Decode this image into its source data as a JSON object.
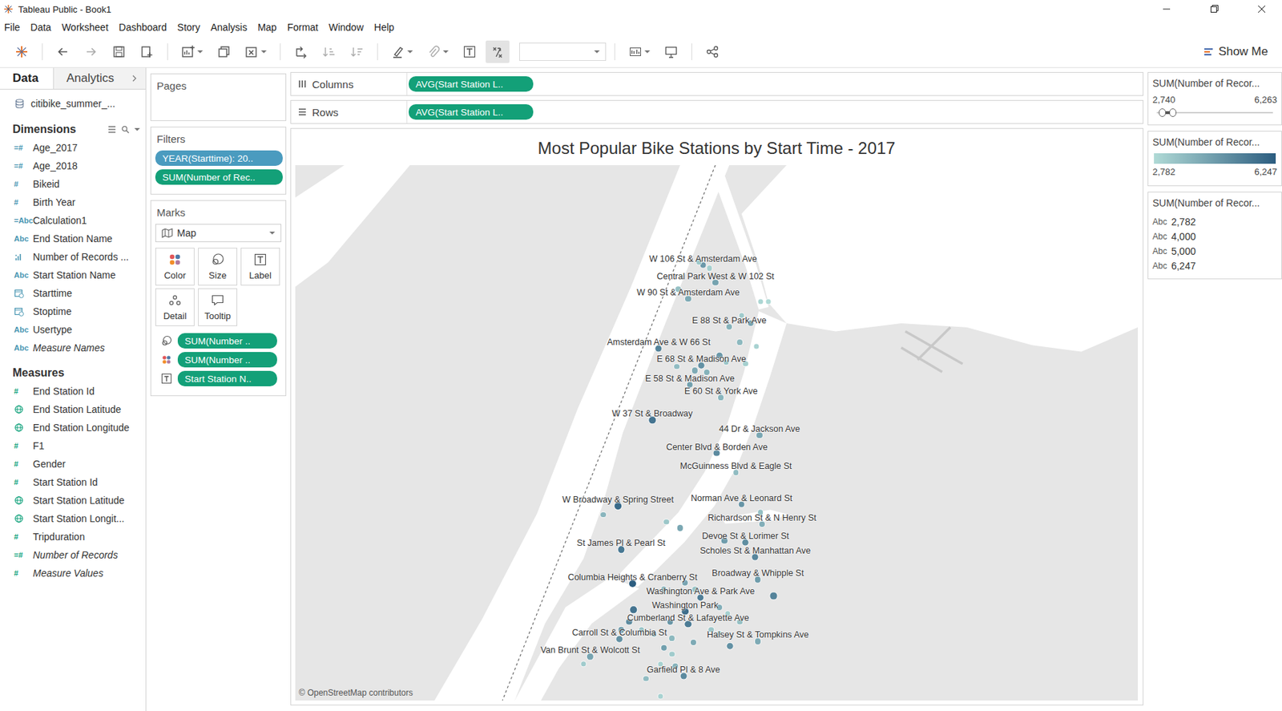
{
  "window": {
    "title": "Tableau Public - Book1"
  },
  "menu": [
    "File",
    "Data",
    "Worksheet",
    "Dashboard",
    "Story",
    "Analysis",
    "Map",
    "Format",
    "Window",
    "Help"
  ],
  "toolbar": {
    "show_me": "Show Me"
  },
  "data_pane": {
    "tabs": [
      {
        "label": "Data",
        "selected": true
      },
      {
        "label": "Analytics",
        "selected": false
      }
    ],
    "source": "citibike_summer_...",
    "dimensions_title": "Dimensions",
    "dimensions": [
      {
        "name": "Age_2017",
        "kind": "glyph",
        "glyph": "=#",
        "italic": false
      },
      {
        "name": "Age_2018",
        "kind": "glyph",
        "glyph": "=#",
        "italic": false
      },
      {
        "name": "Bikeid",
        "kind": "glyph",
        "glyph": "#",
        "italic": false
      },
      {
        "name": "Birth Year",
        "kind": "glyph",
        "glyph": "#",
        "italic": false
      },
      {
        "name": "Calculation1",
        "kind": "glyph",
        "glyph": "=Abc",
        "italic": false
      },
      {
        "name": "End Station Name",
        "kind": "glyph",
        "glyph": "Abc",
        "italic": false
      },
      {
        "name": "Number of Records ...",
        "kind": "bars",
        "glyph": "",
        "italic": false
      },
      {
        "name": "Start Station Name",
        "kind": "glyph",
        "glyph": "Abc",
        "italic": false
      },
      {
        "name": "Starttime",
        "kind": "date",
        "glyph": "",
        "italic": false
      },
      {
        "name": "Stoptime",
        "kind": "date",
        "glyph": "",
        "italic": false
      },
      {
        "name": "Usertype",
        "kind": "glyph",
        "glyph": "Abc",
        "italic": false
      },
      {
        "name": "Measure Names",
        "kind": "glyph",
        "glyph": "Abc",
        "italic": true
      }
    ],
    "measures_title": "Measures",
    "measures": [
      {
        "name": "End Station Id",
        "kind": "glyph",
        "glyph": "#",
        "italic": false
      },
      {
        "name": "End Station Latitude",
        "kind": "geo",
        "glyph": "",
        "italic": false
      },
      {
        "name": "End Station Longitude",
        "kind": "geo",
        "glyph": "",
        "italic": false
      },
      {
        "name": "F1",
        "kind": "glyph",
        "glyph": "#",
        "italic": false
      },
      {
        "name": "Gender",
        "kind": "glyph",
        "glyph": "#",
        "italic": false
      },
      {
        "name": "Start Station Id",
        "kind": "glyph",
        "glyph": "#",
        "italic": false
      },
      {
        "name": "Start Station Latitude",
        "kind": "geo",
        "glyph": "",
        "italic": false
      },
      {
        "name": "Start Station Longit...",
        "kind": "geo",
        "glyph": "",
        "italic": false
      },
      {
        "name": "Tripduration",
        "kind": "glyph",
        "glyph": "#",
        "italic": false
      },
      {
        "name": "Number of Records",
        "kind": "glyph",
        "glyph": "=#",
        "italic": true
      },
      {
        "name": "Measure Values",
        "kind": "glyph",
        "glyph": "#",
        "italic": true
      }
    ]
  },
  "pages": {
    "title": "Pages"
  },
  "filters": {
    "title": "Filters",
    "pills": [
      {
        "label": "YEAR(Starttime): 20..",
        "kind": "dimension"
      },
      {
        "label": "SUM(Number of Rec..",
        "kind": "measure"
      }
    ]
  },
  "marks": {
    "title": "Marks",
    "mark_type": "Map",
    "buttons": [
      {
        "label": "Color",
        "kind": "color"
      },
      {
        "label": "Size",
        "kind": "size"
      },
      {
        "label": "Label",
        "kind": "label"
      },
      {
        "label": "Detail",
        "kind": "detail"
      },
      {
        "label": "Tooltip",
        "kind": "tooltip"
      }
    ],
    "pills": [
      {
        "label": "SUM(Number ..",
        "encoding": "size"
      },
      {
        "label": "SUM(Number ..",
        "encoding": "color"
      },
      {
        "label": "Start Station N..",
        "encoding": "label"
      }
    ]
  },
  "shelves": [
    {
      "label": "Columns",
      "kind": "columns",
      "pill": "AVG(Start Station L.."
    },
    {
      "label": "Rows",
      "kind": "rows",
      "pill": "AVG(Start Station L.."
    }
  ],
  "viz": {
    "title": "Most Popular Bike Stations by Start Time - 2017",
    "attribution": "© OpenStreetMap contributors",
    "points": [
      {
        "label": "W 106 St & Amsterdam Ave",
        "lat": 40.8027,
        "lon": -73.9548,
        "count": 4600
      },
      {
        "label": "Central Park West & W 102 St",
        "lat": 40.7961,
        "lon": -73.9504,
        "count": 4300
      },
      {
        "label": "W 90 St & Amsterdam Ave",
        "lat": 40.79,
        "lon": -73.9601,
        "count": 4100
      },
      {
        "label": "E 88 St & Park Ave",
        "lat": 40.7797,
        "lon": -73.9455,
        "count": 3900
      },
      {
        "label": "Amsterdam Ave & W 66 St",
        "lat": 40.7715,
        "lon": -73.9706,
        "count": 5200
      },
      {
        "label": "E 68 St & Madison Ave",
        "lat": 40.7652,
        "lon": -73.9554,
        "count": 4800
      },
      {
        "label": "E 58 St & Madison Ave",
        "lat": 40.7579,
        "lon": -73.9595,
        "count": 4400
      },
      {
        "label": "E 60 St & York Ave",
        "lat": 40.7533,
        "lon": -73.9484,
        "count": 3800
      },
      {
        "label": "W 37 St & Broadway",
        "lat": 40.7448,
        "lon": -73.9729,
        "count": 5600
      },
      {
        "label": "44 Dr & Jackson Ave",
        "lat": 40.7391,
        "lon": -73.9347,
        "count": 4200
      },
      {
        "label": "Center Blvd & Borden Ave",
        "lat": 40.7324,
        "lon": -73.9499,
        "count": 5000
      },
      {
        "label": "McGuinness Blvd & Eagle St",
        "lat": 40.7251,
        "lon": -73.9431,
        "count": 3600
      },
      {
        "label": "W Broadway & Spring Street",
        "lat": 40.7127,
        "lon": -73.9851,
        "count": 5900
      },
      {
        "label": "Norman Ave & Leonard St",
        "lat": 40.7133,
        "lon": -73.9411,
        "count": 4700
      },
      {
        "label": "Richardson St & N Henry St",
        "lat": 40.7058,
        "lon": -73.9338,
        "count": 4000
      },
      {
        "label": "Devoe St & Lorimer St",
        "lat": 40.6991,
        "lon": -73.9397,
        "count": 4900
      },
      {
        "label": "Scholes St & Manhattan Ave",
        "lat": 40.6936,
        "lon": -73.9362,
        "count": 5100
      },
      {
        "label": "St James Pl & Pearl St",
        "lat": 40.6964,
        "lon": -73.984,
        "count": 5500
      },
      {
        "label": "Broadway & Whipple St",
        "lat": 40.6852,
        "lon": -73.9353,
        "count": 4500
      },
      {
        "label": "Columbia Heights & Cranberry St",
        "lat": 40.6836,
        "lon": -73.9799,
        "count": 6247
      },
      {
        "label": "Washington Ave & Park Ave",
        "lat": 40.6785,
        "lon": -73.9557,
        "count": 5300
      },
      {
        "label": "Washington Park",
        "lat": 40.6733,
        "lon": -73.9612,
        "count": 5800
      },
      {
        "label": "Cumberland St & Lafayette Ave",
        "lat": 40.6685,
        "lon": -73.9601,
        "count": 5400
      },
      {
        "label": "Carroll St & Columbia St",
        "lat": 40.663,
        "lon": -73.9846,
        "count": 4800
      },
      {
        "label": "Halsey St & Tompkins Ave",
        "lat": 40.6621,
        "lon": -73.9353,
        "count": 4100
      },
      {
        "label": "Van Brunt St & Wolcott St",
        "lat": 40.6564,
        "lon": -73.995,
        "count": 4300
      },
      {
        "label": "Garfield Pl & 8 Ave",
        "lat": 40.6491,
        "lon": -73.9618,
        "count": 5000
      },
      {
        "label": "",
        "lat": 40.8039,
        "lon": -73.9563,
        "count": 3300
      },
      {
        "label": "",
        "lat": 40.8015,
        "lon": -73.9525,
        "count": 3100
      },
      {
        "label": "",
        "lat": 40.7936,
        "lon": -73.9636,
        "count": 3500
      },
      {
        "label": "",
        "lat": 40.7891,
        "lon": -73.9344,
        "count": 2900
      },
      {
        "label": "",
        "lat": 40.7891,
        "lon": -73.9315,
        "count": 2782
      },
      {
        "label": "",
        "lat": 40.7839,
        "lon": -73.9411,
        "count": 3200
      },
      {
        "label": "",
        "lat": 40.7809,
        "lon": -73.9379,
        "count": 4400
      },
      {
        "label": "",
        "lat": 40.7739,
        "lon": -73.9417,
        "count": 3700
      },
      {
        "label": "",
        "lat": 40.7724,
        "lon": -73.9359,
        "count": 3000
      },
      {
        "label": "",
        "lat": 40.7688,
        "lon": -73.949,
        "count": 4600
      },
      {
        "label": "",
        "lat": 40.7664,
        "lon": -73.9466,
        "count": 3400
      },
      {
        "label": "",
        "lat": 40.7633,
        "lon": -73.9577,
        "count": 4100
      },
      {
        "label": "",
        "lat": 40.7648,
        "lon": -73.9641,
        "count": 3600
      },
      {
        "label": "",
        "lat": 40.7627,
        "lon": -73.9534,
        "count": 3900
      },
      {
        "label": "",
        "lat": 40.7658,
        "lon": -73.9397,
        "count": 3100
      },
      {
        "label": "",
        "lat": 40.7067,
        "lon": -73.9679,
        "count": 3300
      },
      {
        "label": "",
        "lat": 40.7045,
        "lon": -73.963,
        "count": 4200
      },
      {
        "label": "",
        "lat": 40.7094,
        "lon": -73.9904,
        "count": 3800
      },
      {
        "label": "",
        "lat": 40.7103,
        "lon": -73.9344,
        "count": 3500
      },
      {
        "label": "",
        "lat": 40.6997,
        "lon": -73.9472,
        "count": 4500
      },
      {
        "label": "",
        "lat": 40.6791,
        "lon": -73.9297,
        "count": 5200
      },
      {
        "label": "",
        "lat": 40.6603,
        "lon": -73.9452,
        "count": 4800
      },
      {
        "label": "",
        "lat": 40.6739,
        "lon": -73.9796,
        "count": 5600
      },
      {
        "label": "",
        "lat": 40.6664,
        "lon": -73.9767,
        "count": 3400
      },
      {
        "label": "",
        "lat": 40.6649,
        "lon": -73.9723,
        "count": 3700
      },
      {
        "label": "",
        "lat": 40.6597,
        "lon": -73.9688,
        "count": 4400
      },
      {
        "label": "",
        "lat": 40.6573,
        "lon": -73.9659,
        "count": 3200
      },
      {
        "label": "",
        "lat": 40.6527,
        "lon": -73.9647,
        "count": 3900
      },
      {
        "label": "",
        "lat": 40.6536,
        "lon": -73.97,
        "count": 3000
      },
      {
        "label": "",
        "lat": 40.6482,
        "lon": -73.9752,
        "count": 3600
      },
      {
        "label": "",
        "lat": 40.6618,
        "lon": -73.9583,
        "count": 4100
      },
      {
        "label": "",
        "lat": 40.6664,
        "lon": -73.9519,
        "count": 3300
      },
      {
        "label": "",
        "lat": 40.6652,
        "lon": -73.949,
        "count": 2900
      },
      {
        "label": "",
        "lat": 40.6694,
        "lon": -73.9417,
        "count": 3500
      },
      {
        "label": "",
        "lat": 40.6749,
        "lon": -73.949,
        "count": 4000
      },
      {
        "label": "",
        "lat": 40.6724,
        "lon": -73.9461,
        "count": 3100
      },
      {
        "label": "",
        "lat": 40.6694,
        "lon": -73.9665,
        "count": 4700
      },
      {
        "label": "",
        "lat": 40.6815,
        "lon": -73.9688,
        "count": 3800
      },
      {
        "label": "",
        "lat": 40.6815,
        "lon": -73.9577,
        "count": 3400
      },
      {
        "label": "",
        "lat": 40.6839,
        "lon": -73.9612,
        "count": 4300
      },
      {
        "label": "",
        "lat": 40.6415,
        "lon": -73.97,
        "count": 3000
      },
      {
        "label": "",
        "lat": 40.6694,
        "lon": -73.9811,
        "count": 5000
      },
      {
        "label": "",
        "lat": 40.6664,
        "lon": -73.984,
        "count": 4500
      },
      {
        "label": "",
        "lat": 40.6633,
        "lon": -73.9659,
        "count": 3700
      },
      {
        "label": "",
        "lat": 40.6536,
        "lon": -73.9974,
        "count": 3200
      }
    ]
  },
  "legends": {
    "filter": {
      "title": "SUM(Number of Recor...",
      "min": "2,740",
      "max": "6,263",
      "level_low": 0.05,
      "level_high": 0.14
    },
    "color": {
      "title": "SUM(Number of Recor...",
      "min": "2,782",
      "max": "6,247"
    },
    "size": {
      "title": "SUM(Number of Recor...",
      "items": [
        {
          "glyph": "Abc",
          "value": "2,782"
        },
        {
          "glyph": "Abc",
          "value": "4,000"
        },
        {
          "glyph": "Abc",
          "value": "5,000"
        },
        {
          "glyph": "Abc",
          "value": "6,247"
        }
      ]
    }
  }
}
